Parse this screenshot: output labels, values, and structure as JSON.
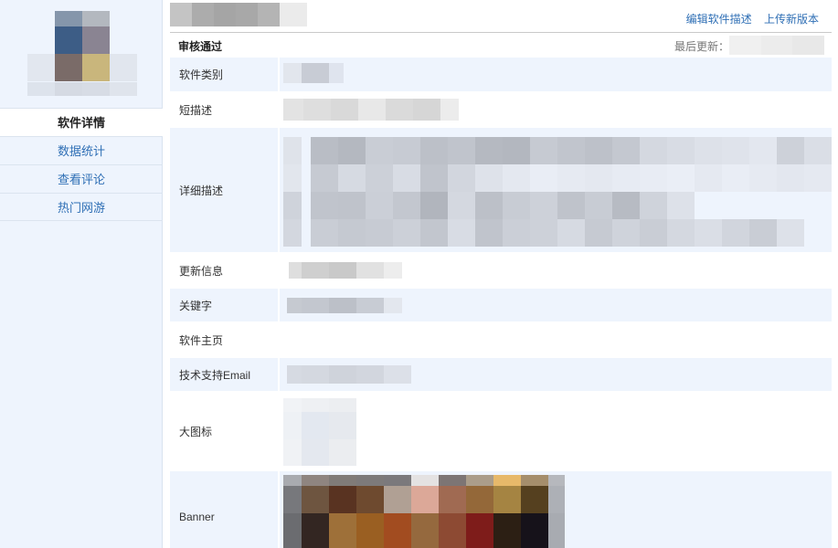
{
  "sidebar": {
    "nav": [
      {
        "label": "软件详情",
        "active": true
      },
      {
        "label": "数据统计",
        "active": false
      },
      {
        "label": "查看评论",
        "active": false
      },
      {
        "label": "热门网游",
        "active": false
      }
    ]
  },
  "header": {
    "edit_link": "编辑软件描述",
    "upload_link": "上传新版本"
  },
  "status": {
    "review": "审核通过",
    "last_updated_label": "最后更新："
  },
  "details": {
    "category_label": "软件类别",
    "short_desc_label": "短描述",
    "long_desc_label": "详细描述",
    "update_info_label": "更新信息",
    "keywords_label": "关键字",
    "homepage_label": "软件主页",
    "support_email_label": "技术支持Email",
    "large_icon_label": "大图标",
    "banner_label": "Banner"
  },
  "colors": {
    "accent": "#2f6fb5",
    "alt_row": "#eef4fd",
    "sidebar_bg": "#eef4fd"
  }
}
